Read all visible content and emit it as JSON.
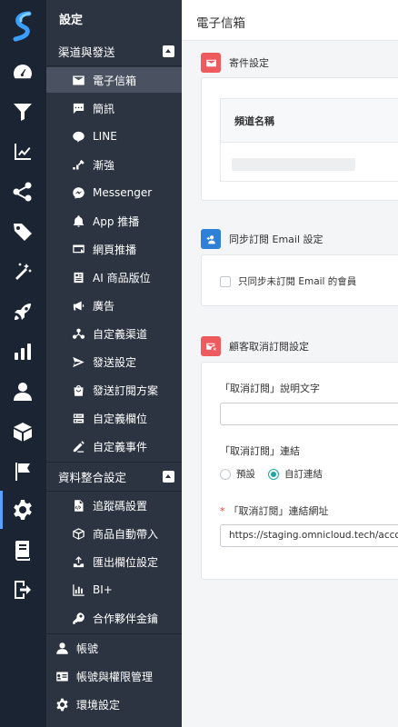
{
  "nav": {
    "title": "設定",
    "group_channels": "渠道與發送",
    "channel_items": [
      {
        "label": "電子信箱",
        "icon": "envelope-icon",
        "active": true
      },
      {
        "label": "簡訊",
        "icon": "sms-icon"
      },
      {
        "label": "LINE",
        "icon": "line-icon"
      },
      {
        "label": "漸強",
        "icon": "crescendo-icon"
      },
      {
        "label": "Messenger",
        "icon": "messenger-icon"
      },
      {
        "label": "App 推播",
        "icon": "bell-icon"
      },
      {
        "label": "網頁推播",
        "icon": "web-push-icon"
      },
      {
        "label": "AI 商品版位",
        "icon": "ai-slot-icon"
      },
      {
        "label": "廣告",
        "icon": "megaphone-icon"
      },
      {
        "label": "自定義渠道",
        "icon": "custom-channel-icon"
      },
      {
        "label": "發送設定",
        "icon": "send-icon"
      },
      {
        "label": "發送訂閱方案",
        "icon": "shopping-bag-icon"
      },
      {
        "label": "自定義欄位",
        "icon": "custom-field-icon"
      },
      {
        "label": "自定義事件",
        "icon": "pen-icon"
      }
    ],
    "group_data": "資料整合設定",
    "data_items": [
      {
        "label": "追蹤碼設置",
        "icon": "tracking-code-icon"
      },
      {
        "label": "商品自動帶入",
        "icon": "product-import-icon"
      },
      {
        "label": "匯出欄位設定",
        "icon": "export-icon"
      },
      {
        "label": "BI+",
        "icon": "chart-icon"
      },
      {
        "label": "合作夥伴金鑰",
        "icon": "key-icon"
      }
    ],
    "bottom_items": [
      {
        "label": "帳號",
        "icon": "user-icon"
      },
      {
        "label": "帳號與權限管理",
        "icon": "id-card-icon"
      },
      {
        "label": "環境設定",
        "icon": "gear-icon"
      }
    ]
  },
  "header": {
    "title": "電子信箱"
  },
  "sender": {
    "title": "寄件設定",
    "table_header": "頻道名稱"
  },
  "sync": {
    "title": "同步訂閱 Email 設定",
    "checkbox_label": "只同步未訂閱 Email 的會員"
  },
  "unsub": {
    "title": "顧客取消訂閱設定",
    "desc_label": "「取消訂閱」說明文字",
    "desc_value": "",
    "link_label": "「取消訂閱」連結",
    "radio_default": "預設",
    "radio_custom": "自訂連結",
    "url_label": "「取消訂閱」連結網址",
    "url_required_mark": "*",
    "url_value": "https://staging.omnicloud.tech/account/unsubscribe"
  },
  "colors": {
    "rail_bg": "#1b2433",
    "nav_bg": "#2c3441",
    "accent_red": "#ef5a5f",
    "accent_blue": "#2d7fd8",
    "radio_teal": "#1fa6a0"
  }
}
